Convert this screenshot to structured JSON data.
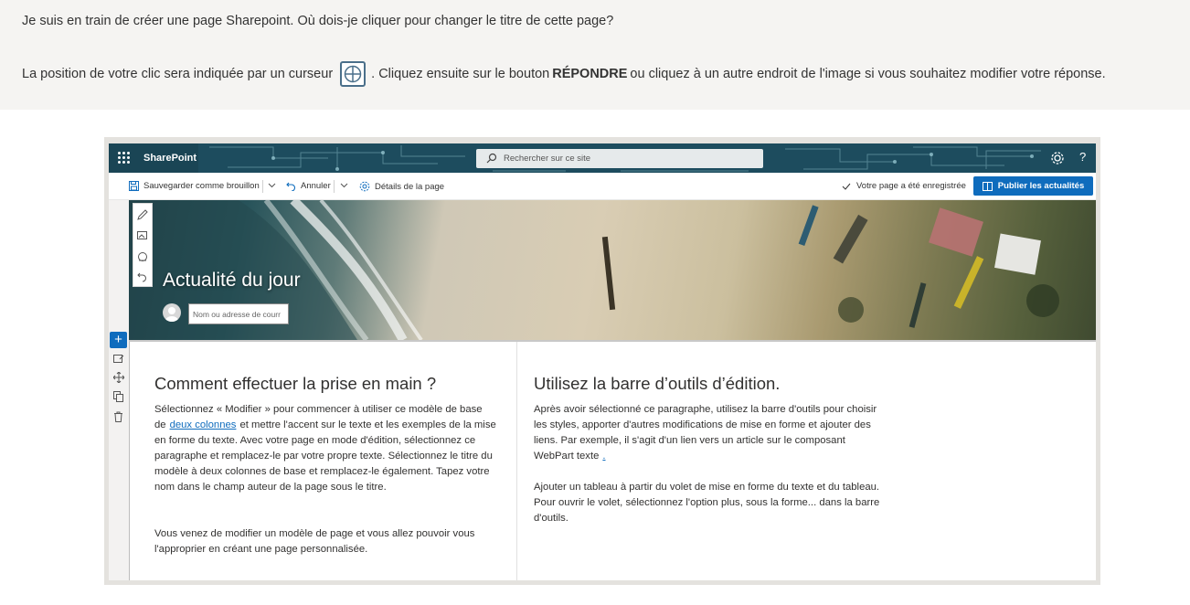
{
  "quiz": {
    "question": "Je suis en train de créer une page Sharepoint. Où dois-je cliquer pour changer le titre de cette page?",
    "instruction_part1": "La position de votre clic sera indiquée par un curseur",
    "instruction_part2": ". Cliquez ensuite sur le bouton",
    "instruction_bold": "RÉPONDRE",
    "instruction_part3": "ou cliquez à un autre endroit de l'image si vous souhaitez modifier votre réponse."
  },
  "app": {
    "brand": "SharePoint",
    "search_placeholder": "Rechercher sur ce site",
    "help": "?"
  },
  "commandbar": {
    "save_draft": "Sauvegarder comme brouillon",
    "undo": "Annuler",
    "page_details": "Détails de la page",
    "saved_status": "Votre page a été enregistrée",
    "publish": "Publier les actualités"
  },
  "hero": {
    "title": "Actualité du jour",
    "author_placeholder": "Nom ou adresse de courr"
  },
  "columns": [
    {
      "heading": "Comment effectuer la prise en main ?",
      "para1_before": "Sélectionnez « Modifier » pour commencer à utiliser ce modèle de base de",
      "para1_link": "deux colonnes",
      "para1_after": "et mettre l'accent sur le texte et les exemples de la mise en forme du texte. Avec votre page en mode d'édition, sélectionnez ce paragraphe et remplacez-le par votre propre texte. Sélectionnez le titre du modèle à deux colonnes de base et remplacez-le également. Tapez votre nom dans le champ auteur de la page sous le titre.",
      "para2": "Vous venez de modifier un modèle de page et vous allez pouvoir vous l'approprier en créant une page personnalisée."
    },
    {
      "heading": "Utilisez la barre d’outils d’édition.",
      "para1_before": "Après avoir sélectionné ce paragraphe, utilisez la barre d'outils pour choisir les styles, apporter d'autres modifications de mise en forme et ajouter des liens. Par exemple, il s'agit d'un lien vers un article sur le composant WebPart texte",
      "para1_link": ".",
      "para2": "Ajouter un tableau à partir du volet de mise en forme du texte et du tableau. Pour ouvrir le volet, sélectionnez l'option plus, sous la forme... dans la barre d'outils."
    }
  ],
  "colors": {
    "accent": "#0f6cbd",
    "banner": "#1d4c5e"
  },
  "icons": [
    "waffle-icon",
    "search-icon",
    "gear-icon",
    "save-icon",
    "undo-icon",
    "settings-icon",
    "check-icon",
    "publish-icon",
    "edit-icon",
    "plus-icon",
    "move-icon",
    "copy-icon",
    "delete-icon"
  ]
}
